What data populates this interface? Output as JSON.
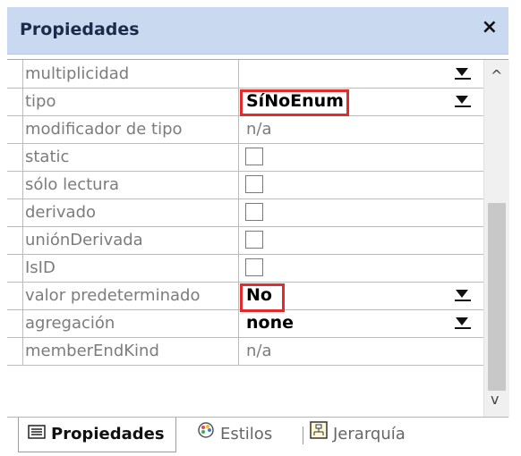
{
  "panel": {
    "title": "Propiedades",
    "close_glyph": "×"
  },
  "rows": [
    {
      "label": "multiplicidad",
      "type": "dropdown",
      "value": ""
    },
    {
      "label": "tipo",
      "type": "dropdown",
      "value": "SíNoEnum",
      "highlight": true
    },
    {
      "label": "modificador de tipo",
      "type": "text",
      "value": "n/a"
    },
    {
      "label": "static",
      "type": "checkbox"
    },
    {
      "label": "sólo lectura",
      "type": "checkbox"
    },
    {
      "label": "derivado",
      "type": "checkbox"
    },
    {
      "label": "uniónDerivada",
      "type": "checkbox"
    },
    {
      "label": "IsID",
      "type": "checkbox"
    },
    {
      "label": "valor predeterminado",
      "type": "dropdown",
      "value": "No",
      "highlight": true
    },
    {
      "label": "agregación",
      "type": "dropdown",
      "value": "none"
    },
    {
      "label": "memberEndKind",
      "type": "text",
      "value": "n/a"
    }
  ],
  "tabs": [
    {
      "label": "Propiedades",
      "icon": "properties-icon",
      "active": true
    },
    {
      "label": "Estilos",
      "icon": "palette-icon",
      "active": false
    },
    {
      "label": "Jerarquía",
      "icon": "hierarchy-icon",
      "active": false
    }
  ],
  "scrollbar": {
    "up_glyph": "^",
    "down_glyph": "v"
  },
  "colors": {
    "titlebar": "#c9daf0",
    "highlight": "#e32b2b",
    "label_text": "#7c7c7c"
  }
}
